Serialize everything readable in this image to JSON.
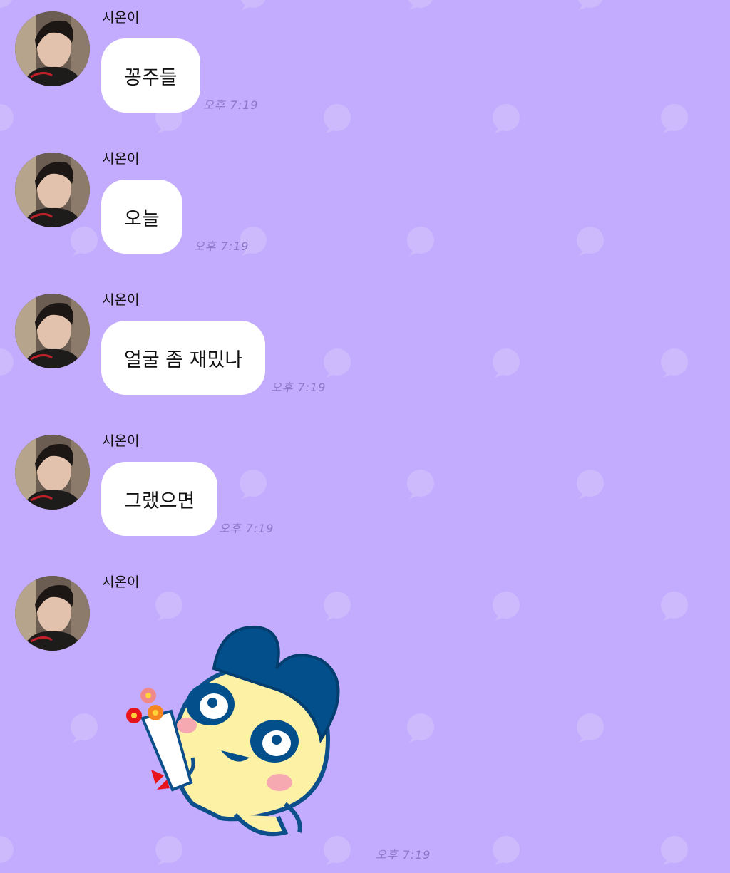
{
  "chat": {
    "messages": [
      {
        "sender": "시온이",
        "text": "꽁주들",
        "time": "오후 7:19"
      },
      {
        "sender": "시온이",
        "text": "오늘",
        "time": "오후 7:19"
      },
      {
        "sender": "시온이",
        "text": "얼굴 좀 재밌나",
        "time": "오후 7:19"
      },
      {
        "sender": "시온이",
        "text": "그랬으면",
        "time": "오후 7:19"
      },
      {
        "sender": "시온이",
        "sticker": "tamagotchi-character-holding-bouquet",
        "time": "오후 7:19"
      }
    ]
  },
  "theme": {
    "background": "#c3acfd",
    "bubble": "#ffffff",
    "time_color": "#8d76c7",
    "pattern_icon": "speech-bubble-icon"
  }
}
